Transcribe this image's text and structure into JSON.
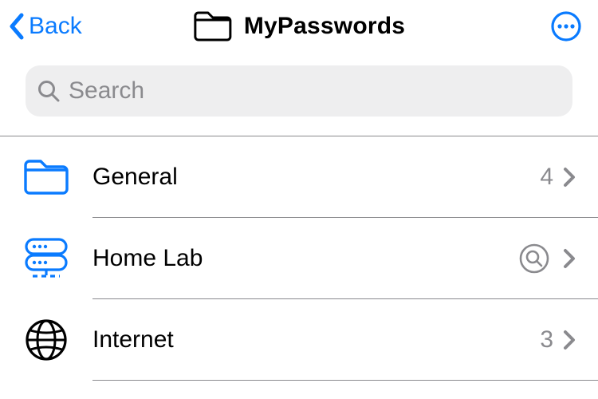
{
  "nav": {
    "back_label": "Back",
    "title": "MyPasswords"
  },
  "search": {
    "placeholder": "Search",
    "value": ""
  },
  "folders": [
    {
      "id": "general",
      "label": "General",
      "count": "4",
      "has_count": true,
      "has_search_badge": false
    },
    {
      "id": "home-lab",
      "label": "Home Lab",
      "count": "",
      "has_count": false,
      "has_search_badge": true
    },
    {
      "id": "internet",
      "label": "Internet",
      "count": "3",
      "has_count": true,
      "has_search_badge": false
    }
  ],
  "colors": {
    "accent": "#0a7bff",
    "muted": "#8a8a8e"
  }
}
